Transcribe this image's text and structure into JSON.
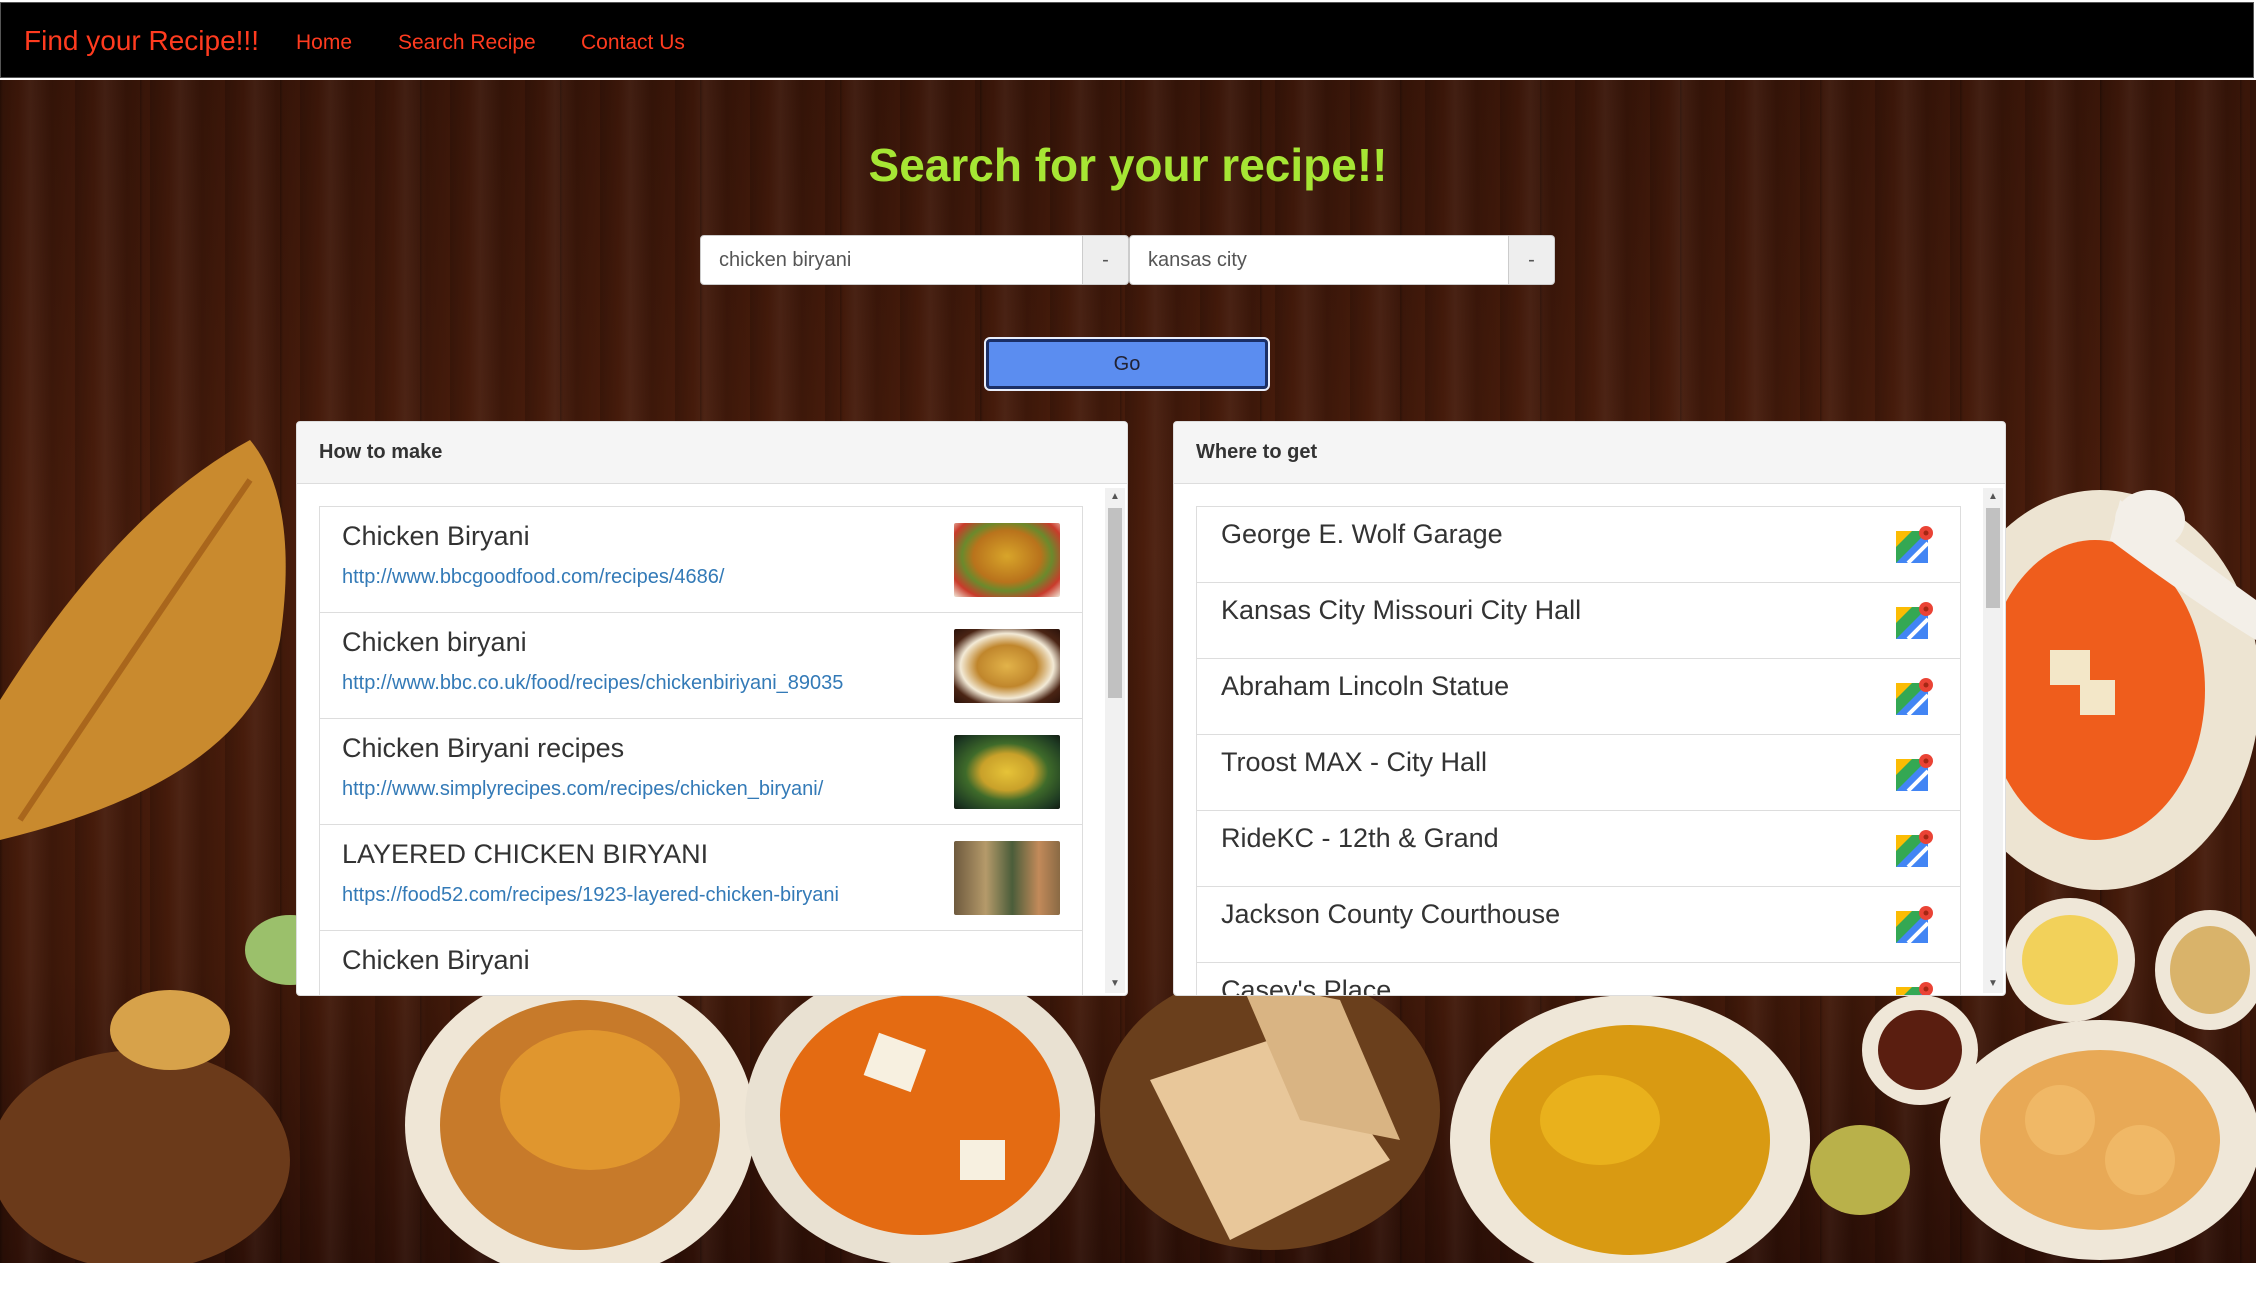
{
  "navbar": {
    "brand": "Find your Recipe!!!",
    "links": [
      "Home",
      "Search Recipe",
      "Contact Us"
    ]
  },
  "search": {
    "title": "Search for your recipe!!",
    "recipe_value": "chicken biryani",
    "location_value": "kansas city",
    "addon_label": "-",
    "go_label": "Go"
  },
  "how_to_make": {
    "heading": "How to make",
    "items": [
      {
        "title": "Chicken Biryani",
        "url": "http://www.bbcgoodfood.com/recipes/4686/"
      },
      {
        "title": "Chicken biryani",
        "url": "http://www.bbc.co.uk/food/recipes/chickenbiriyani_89035"
      },
      {
        "title": "Chicken Biryani recipes",
        "url": "http://www.simplyrecipes.com/recipes/chicken_biryani/"
      },
      {
        "title": "LAYERED CHICKEN BIRYANI",
        "url": "https://food52.com/recipes/1923-layered-chicken-biryani"
      },
      {
        "title": "Chicken Biryani",
        "url": ""
      }
    ]
  },
  "where_to_get": {
    "heading": "Where to get",
    "places": [
      "George E. Wolf Garage",
      "Kansas City Missouri City Hall",
      "Abraham Lincoln Statue",
      "Troost MAX - City Hall",
      "RideKC - 12th & Grand",
      "Jackson County Courthouse",
      "Casey's Place"
    ]
  },
  "icons": {
    "map": "google-maps-icon",
    "scroll_up": "scroll-up-arrow-icon",
    "scroll_down": "scroll-down-arrow-icon"
  },
  "colors": {
    "brand": "#ff3b1f",
    "title": "#a6e634",
    "link": "#337ab7",
    "go_button": "#5b8df0"
  }
}
